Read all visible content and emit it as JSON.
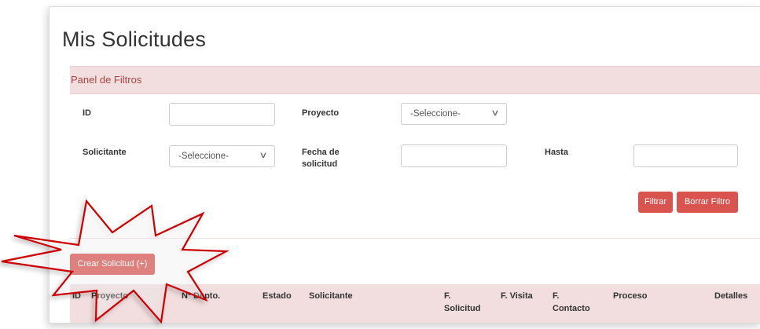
{
  "page": {
    "title": "Mis Solicitudes"
  },
  "filters": {
    "panel_title": "Panel de Filtros",
    "id_label": "ID",
    "id_value": "",
    "proyecto_label": "Proyecto",
    "proyecto_value": "-Seleccione-",
    "solicitante_label": "Solicitante",
    "solicitante_value": "-Seleccione-",
    "fecha_label_1": "Fecha de",
    "fecha_label_2": "solicitud",
    "fecha_value": "",
    "hasta_label": "Hasta",
    "hasta_value": "",
    "filtrar_label": "Filtrar",
    "borrar_label": "Borrar Filtro"
  },
  "actions": {
    "crear_label": "Crear Solicitud (+)"
  },
  "table": {
    "headers": [
      {
        "line1": "",
        "line2": "ID"
      },
      {
        "line1": "",
        "line2": "Proyecto"
      },
      {
        "line1": "",
        "line2": "Nº Depto."
      },
      {
        "line1": "",
        "line2": "Estado"
      },
      {
        "line1": "",
        "line2": "Solicitante"
      },
      {
        "line1": "F.",
        "line2": "Solicitud"
      },
      {
        "line1": "",
        "line2": "F. Visita"
      },
      {
        "line1": "F.",
        "line2": "Contacto"
      },
      {
        "line1": "",
        "line2": "Proceso"
      },
      {
        "line1": "",
        "line2": "Detalles"
      }
    ]
  },
  "annotation": {
    "icon": "starburst-highlight-icon",
    "color": "#cc0000"
  },
  "colors": {
    "accent": "#d9534f",
    "panel_bg": "#f2dede",
    "panel_text": "#a94442"
  }
}
